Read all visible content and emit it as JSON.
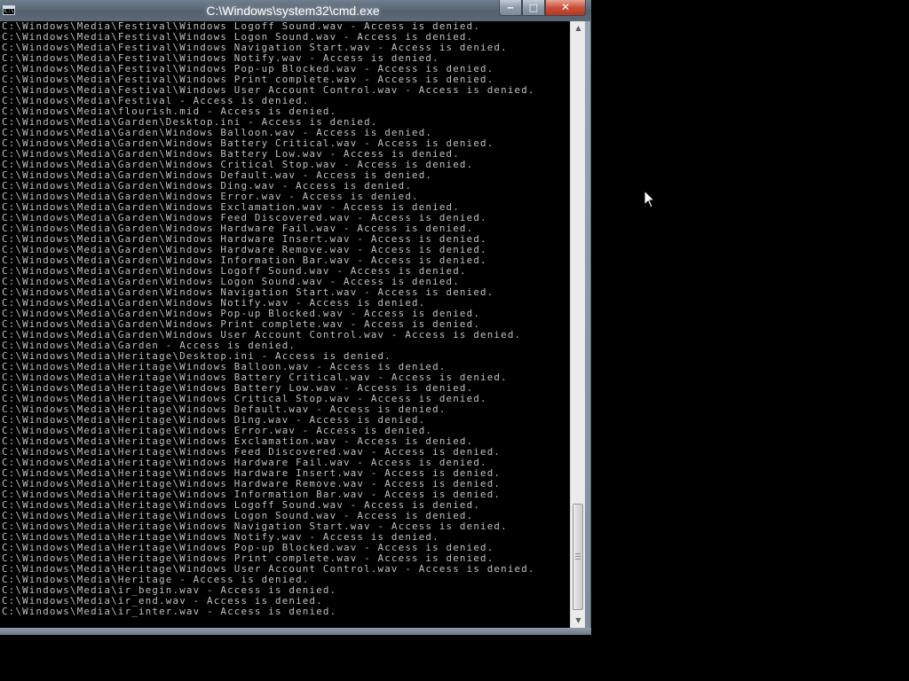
{
  "window": {
    "title": "C:\\Windows\\system32\\cmd.exe",
    "app_icon_text": "C:\\",
    "icons": {
      "app": "cmd-icon",
      "minimize": "minimize-icon",
      "maximize": "maximize-icon",
      "close": "close-icon",
      "cursor": "mouse-pointer-icon"
    },
    "controls": {
      "minimize": "‒",
      "maximize": "□",
      "close": "✕"
    }
  },
  "console": {
    "foreground": "#c0c0c0",
    "background": "#000000",
    "lines": [
      "C:\\Windows\\Media\\Festival\\Windows Logoff Sound.wav - Access is denied.",
      "C:\\Windows\\Media\\Festival\\Windows Logon Sound.wav - Access is denied.",
      "C:\\Windows\\Media\\Festival\\Windows Navigation Start.wav - Access is denied.",
      "C:\\Windows\\Media\\Festival\\Windows Notify.wav - Access is denied.",
      "C:\\Windows\\Media\\Festival\\Windows Pop-up Blocked.wav - Access is denied.",
      "C:\\Windows\\Media\\Festival\\Windows Print complete.wav - Access is denied.",
      "C:\\Windows\\Media\\Festival\\Windows User Account Control.wav - Access is denied.",
      "C:\\Windows\\Media\\Festival - Access is denied.",
      "C:\\Windows\\Media\\flourish.mid - Access is denied.",
      "C:\\Windows\\Media\\Garden\\Desktop.ini - Access is denied.",
      "C:\\Windows\\Media\\Garden\\Windows Balloon.wav - Access is denied.",
      "C:\\Windows\\Media\\Garden\\Windows Battery Critical.wav - Access is denied.",
      "C:\\Windows\\Media\\Garden\\Windows Battery Low.wav - Access is denied.",
      "C:\\Windows\\Media\\Garden\\Windows Critical Stop.wav - Access is denied.",
      "C:\\Windows\\Media\\Garden\\Windows Default.wav - Access is denied.",
      "C:\\Windows\\Media\\Garden\\Windows Ding.wav - Access is denied.",
      "C:\\Windows\\Media\\Garden\\Windows Error.wav - Access is denied.",
      "C:\\Windows\\Media\\Garden\\Windows Exclamation.wav - Access is denied.",
      "C:\\Windows\\Media\\Garden\\Windows Feed Discovered.wav - Access is denied.",
      "C:\\Windows\\Media\\Garden\\Windows Hardware Fail.wav - Access is denied.",
      "C:\\Windows\\Media\\Garden\\Windows Hardware Insert.wav - Access is denied.",
      "C:\\Windows\\Media\\Garden\\Windows Hardware Remove.wav - Access is denied.",
      "C:\\Windows\\Media\\Garden\\Windows Information Bar.wav - Access is denied.",
      "C:\\Windows\\Media\\Garden\\Windows Logoff Sound.wav - Access is denied.",
      "C:\\Windows\\Media\\Garden\\Windows Logon Sound.wav - Access is denied.",
      "C:\\Windows\\Media\\Garden\\Windows Navigation Start.wav - Access is denied.",
      "C:\\Windows\\Media\\Garden\\Windows Notify.wav - Access is denied.",
      "C:\\Windows\\Media\\Garden\\Windows Pop-up Blocked.wav - Access is denied.",
      "C:\\Windows\\Media\\Garden\\Windows Print complete.wav - Access is denied.",
      "C:\\Windows\\Media\\Garden\\Windows User Account Control.wav - Access is denied.",
      "C:\\Windows\\Media\\Garden - Access is denied.",
      "C:\\Windows\\Media\\Heritage\\Desktop.ini - Access is denied.",
      "C:\\Windows\\Media\\Heritage\\Windows Balloon.wav - Access is denied.",
      "C:\\Windows\\Media\\Heritage\\Windows Battery Critical.wav - Access is denied.",
      "C:\\Windows\\Media\\Heritage\\Windows Battery Low.wav - Access is denied.",
      "C:\\Windows\\Media\\Heritage\\Windows Critical Stop.wav - Access is denied.",
      "C:\\Windows\\Media\\Heritage\\Windows Default.wav - Access is denied.",
      "C:\\Windows\\Media\\Heritage\\Windows Ding.wav - Access is denied.",
      "C:\\Windows\\Media\\Heritage\\Windows Error.wav - Access is denied.",
      "C:\\Windows\\Media\\Heritage\\Windows Exclamation.wav - Access is denied.",
      "C:\\Windows\\Media\\Heritage\\Windows Feed Discovered.wav - Access is denied.",
      "C:\\Windows\\Media\\Heritage\\Windows Hardware Fail.wav - Access is denied.",
      "C:\\Windows\\Media\\Heritage\\Windows Hardware Insert.wav - Access is denied.",
      "C:\\Windows\\Media\\Heritage\\Windows Hardware Remove.wav - Access is denied.",
      "C:\\Windows\\Media\\Heritage\\Windows Information Bar.wav - Access is denied.",
      "C:\\Windows\\Media\\Heritage\\Windows Logoff Sound.wav - Access is denied.",
      "C:\\Windows\\Media\\Heritage\\Windows Logon Sound.wav - Access is denied.",
      "C:\\Windows\\Media\\Heritage\\Windows Navigation Start.wav - Access is denied.",
      "C:\\Windows\\Media\\Heritage\\Windows Notify.wav - Access is denied.",
      "C:\\Windows\\Media\\Heritage\\Windows Pop-up Blocked.wav - Access is denied.",
      "C:\\Windows\\Media\\Heritage\\Windows Print complete.wav - Access is denied.",
      "C:\\Windows\\Media\\Heritage\\Windows User Account Control.wav - Access is denied.",
      "C:\\Windows\\Media\\Heritage - Access is denied.",
      "C:\\Windows\\Media\\ir_begin.wav - Access is denied.",
      "C:\\Windows\\Media\\ir_end.wav - Access is denied.",
      "C:\\Windows\\Media\\ir_inter.wav - Access is denied."
    ]
  },
  "scrollbar": {
    "up_arrow": "▲",
    "down_arrow": "▼",
    "position_fraction": 0.95
  }
}
